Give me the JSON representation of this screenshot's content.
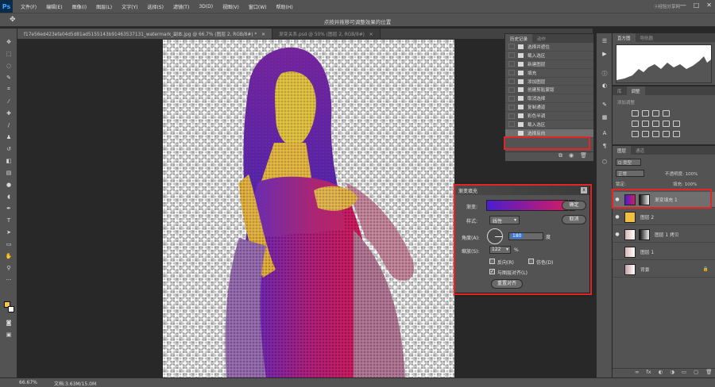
{
  "app": {
    "logo": "Ps"
  },
  "menu": [
    "文件(F)",
    "编辑(E)",
    "图像(I)",
    "图层(L)",
    "文字(Y)",
    "选择(S)",
    "滤镜(T)",
    "3D(D)",
    "视图(V)",
    "窗口(W)",
    "帮助(H)"
  ],
  "window_controls": {
    "minimize": "—",
    "maximize": "□",
    "close": "✕"
  },
  "search_hint": "ⓐ经验分享网",
  "options_bar": {
    "move_icon": "✥",
    "hint": "点按并拖移可调整效果的位置"
  },
  "tabs": [
    {
      "label": "f17e56ed423efa04d5d81ad5155143b91463537131_watermark_副本.jpg @ 66.7% (图层 2, RGB/8#) *",
      "close": "✕"
    },
    {
      "label": "渐变关系.psd @ 50% (图层 2, RGB/8#)",
      "close": "✕"
    }
  ],
  "status": {
    "zoom": "66.67%",
    "doc": "文档:3.63M/15.0M"
  },
  "history_panel": {
    "tabs": [
      "历史记录",
      "动作"
    ],
    "items": [
      "选择并遮住",
      "载入选区",
      "新建图层",
      "填充",
      "添加图层",
      "创建剪贴蒙版",
      "取消选择",
      "复制通道",
      "彩色半调",
      "载入选区",
      "选择反向"
    ],
    "selected_index": 10
  },
  "nav_panel": {
    "tabs": [
      "直方图",
      "导航器"
    ]
  },
  "adjust_panel": {
    "tabs": [
      "库",
      "调整"
    ],
    "hint": "添加调整"
  },
  "layers_panel": {
    "tabs": [
      "图层",
      "通道"
    ],
    "kind_label": "Q 类型",
    "blend_mode": "正常",
    "opacity_label": "不透明度: 100%",
    "lock_label": "锁定:",
    "fill_label": "填充: 100%",
    "layers": [
      {
        "name": "渐变填充 1",
        "visible": true,
        "selected": true
      },
      {
        "name": "图层 2",
        "visible": true,
        "selected": false
      },
      {
        "name": "图层 1 拷贝",
        "visible": true,
        "selected": false
      },
      {
        "name": "图层 1",
        "visible": false,
        "selected": false
      },
      {
        "name": "背景",
        "visible": false,
        "selected": false,
        "lock": "🔒"
      }
    ],
    "footer": [
      "∞",
      "fx",
      "◐",
      "◑",
      "▭",
      "▢",
      "🗑"
    ]
  },
  "gradient_dialog": {
    "title": "渐变填充",
    "close": "x",
    "gradient_label": "渐变:",
    "style_label": "样式:",
    "style_value": "线性",
    "angle_label": "角度(A):",
    "angle_value": "180",
    "angle_unit": "度",
    "scale_label": "缩放(S):",
    "scale_value": "122",
    "scale_unit": "%",
    "reverse_label": "反向(R)",
    "dither_label": "仿色(D)",
    "align_label": "与图层对齐(L)",
    "reset_label": "重置对齐",
    "ok_label": "确定",
    "cancel_label": "取消",
    "align_checked": true
  }
}
